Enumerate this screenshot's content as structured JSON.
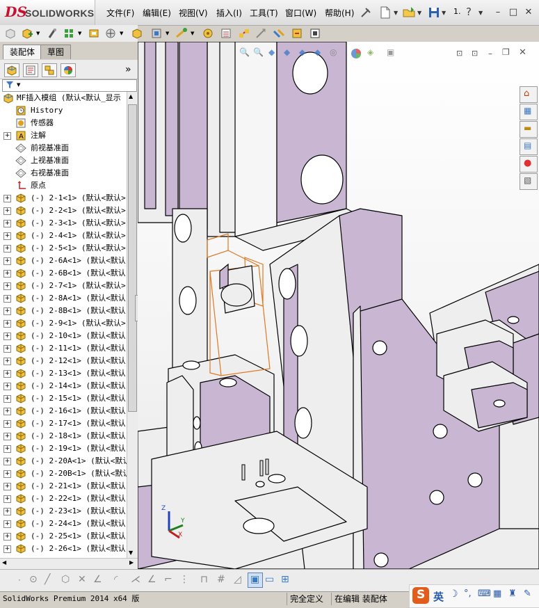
{
  "app": {
    "logo_ds": "DS",
    "logo_text": "SOLIDWORKS",
    "menus": [
      "文件(F)",
      "编辑(E)",
      "视图(V)",
      "插入(I)",
      "工具(T)",
      "窗口(W)",
      "帮助(H)"
    ],
    "help_hint": "1.",
    "help_symbol": "?",
    "win_buttons": [
      "–",
      "□",
      "✕"
    ]
  },
  "manager_tabs": [
    "装配体",
    "草图"
  ],
  "tree": {
    "root": "MF插入模组 (默认<默认_显示",
    "fixed_items": [
      {
        "label": "History",
        "icon": "history-icon",
        "expandable": false
      },
      {
        "label": "传感器",
        "icon": "sensor-icon",
        "expandable": false
      },
      {
        "label": "注解",
        "icon": "annotation-icon",
        "expandable": true
      },
      {
        "label": "前视基准面",
        "icon": "plane-icon",
        "expandable": false
      },
      {
        "label": "上视基准面",
        "icon": "plane-icon",
        "expandable": false
      },
      {
        "label": "右视基准面",
        "icon": "plane-icon",
        "expandable": false
      },
      {
        "label": "原点",
        "icon": "origin-icon",
        "expandable": false
      }
    ],
    "components": [
      "(-) 2-1<1> (默认<默认>",
      "(-) 2-2<1> (默认<默认>",
      "(-) 2-3<1> (默认<默认>",
      "(-) 2-4<1> (默认<默认>",
      "(-) 2-5<1> (默认<默认>",
      "(-) 2-6A<1> (默认<默认",
      "(-) 2-6B<1> (默认<默认",
      "(-) 2-7<1> (默认<默认>",
      "(-) 2-8A<1> (默认<默认",
      "(-) 2-8B<1> (默认<默认",
      "(-) 2-9<1> (默认<默认>",
      "(-) 2-10<1> (默认<默认",
      "(-) 2-11<1> (默认<默认",
      "(-) 2-12<1> (默认<默认",
      "(-) 2-13<1> (默认<默认",
      "(-) 2-14<1> (默认<默认",
      "(-) 2-15<1> (默认<默认",
      "(-) 2-16<1> (默认<默认",
      "(-) 2-17<1> (默认<默认",
      "(-) 2-18<1> (默认<默认",
      "(-) 2-19<1> (默认<默认",
      "(-) 2-20A<1> (默认<默认",
      "(-) 2-20B<1> (默认<默认",
      "(-) 2-21<1> (默认<默认",
      "(-) 2-22<1> (默认<默认",
      "(-) 2-23<1> (默认<默认",
      "(-) 2-24<1> (默认<默认",
      "(-) 2-25<1> (默认<默认",
      "(-) 2-26<1> (默认<默认"
    ]
  },
  "triad": {
    "x": "X",
    "y": "Y",
    "z": "Z"
  },
  "status": {
    "product": "SolidWorks Premium 2014 x64 版",
    "definition": "完全定义",
    "editing": "在编辑 装配体"
  },
  "ime": {
    "mode": "英"
  },
  "colors": {
    "part_face": "#c8b6d2",
    "part_light": "#eeeeee",
    "edge": "#000000",
    "selection": "#e07820",
    "assembly_icon": "#f0c040"
  }
}
